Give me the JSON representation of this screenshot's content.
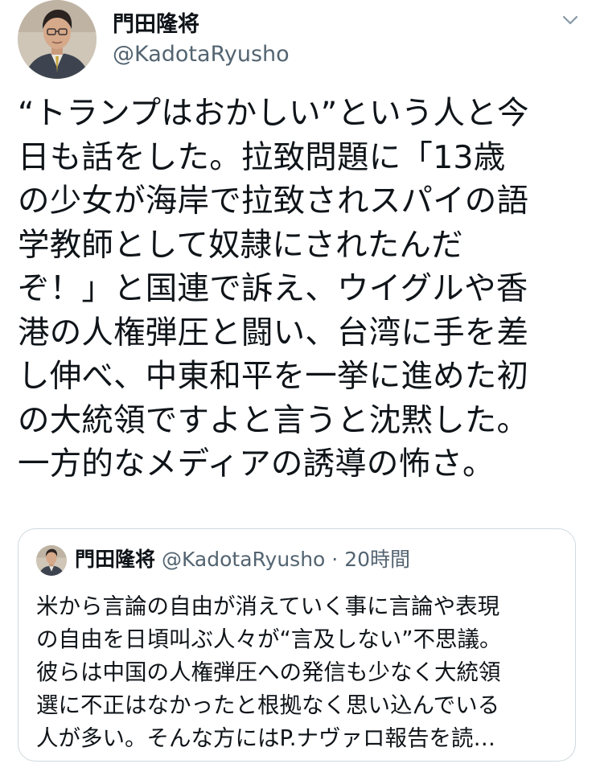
{
  "author": {
    "name": "門田隆将",
    "handle": "@KadotaRyusho"
  },
  "tweet": {
    "text": "“トランプはおかしい”という人と今\n日も話をした。拉致問題に「13歳\nの少女が海岸で拉致されスパイの語\n学教師として奴隷にされたんだ\nぞ！」と国連で訴え、ウイグルや香\n港の人権弾圧と闘い、台湾に手を差\nし伸べ、中東和平を一挙に進めた初\nの大統領ですよと言うと沈黙した。\n一方的なメディアの誘導の怖さ。"
  },
  "quoted_tweet": {
    "name": "門田隆将",
    "handle": "@KadotaRyusho",
    "separator": "·",
    "time": "20時間",
    "text": "米から言論の自由が消えていく事に言論や表現\nの自由を日頃叫ぶ人々が“言及しない”不思議。\n彼らは中国の人権弾圧への発信も少なく大統領\n選に不正はなかったと根拠なく思い込んでいる\n人が多い。そんな方にはP.ナヴァロ報告を読…"
  },
  "icons": {
    "menu": "chevron-down-icon"
  },
  "colors": {
    "text_primary": "#0f1419",
    "text_secondary": "#536471",
    "border": "#cfd9de"
  }
}
